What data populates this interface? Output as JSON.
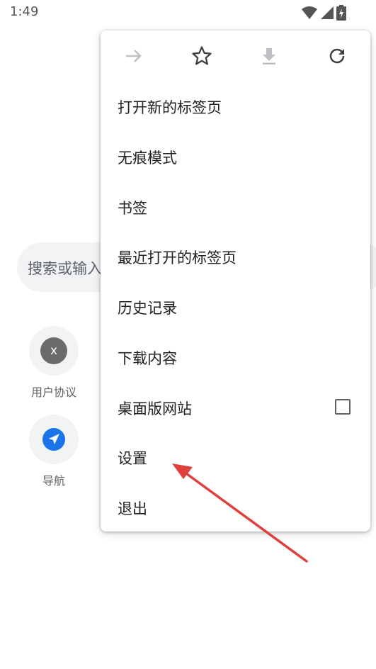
{
  "status_bar": {
    "time": "1:49",
    "icons": [
      "wifi-icon",
      "cell-signal-icon",
      "battery-charging-icon"
    ]
  },
  "background": {
    "search_placeholder": "搜索或输入网址",
    "shortcuts": [
      {
        "label": "用户协议",
        "icon": "x-badge-icon",
        "badge_text": "x"
      },
      {
        "label": "导航",
        "icon": "navigation-icon"
      }
    ]
  },
  "menu": {
    "toolbar": {
      "forward": {
        "icon": "arrow-forward-icon",
        "enabled": false
      },
      "bookmark": {
        "icon": "star-outline-icon",
        "enabled": true
      },
      "download": {
        "icon": "download-icon",
        "enabled": false
      },
      "reload": {
        "icon": "reload-icon",
        "enabled": true
      }
    },
    "items": [
      {
        "label": "打开新的标签页"
      },
      {
        "label": "无痕模式"
      },
      {
        "label": "书签"
      },
      {
        "label": "最近打开的标签页"
      },
      {
        "label": "历史记录"
      },
      {
        "label": "下载内容"
      },
      {
        "label": "桌面版网站",
        "checkbox": false
      },
      {
        "label": "设置"
      },
      {
        "label": "退出"
      }
    ]
  },
  "colors": {
    "annotation_arrow": "#e0403c",
    "nav_icon_blue": "#1a73e8",
    "icon_enabled": "#3c4043",
    "icon_disabled": "#bdc1c6"
  }
}
